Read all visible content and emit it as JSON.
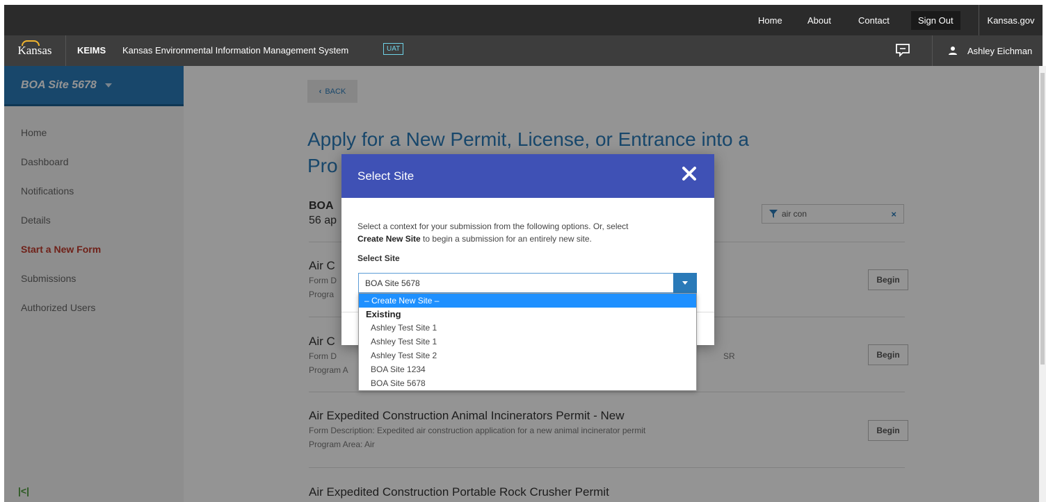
{
  "top_nav": {
    "home": "Home",
    "about": "About",
    "contact": "Contact",
    "sign_out": "Sign Out",
    "kansas_gov": "Kansas.gov"
  },
  "app_bar": {
    "logo_text": "Kansas",
    "short_name": "KEIMS",
    "full_name": "Kansas Environmental Information Management System",
    "env_badge": "UAT",
    "user_name": "Ashley Eichman"
  },
  "sidebar": {
    "site_name": "BOA Site 5678",
    "items": [
      {
        "label": "Home"
      },
      {
        "label": "Dashboard"
      },
      {
        "label": "Notifications"
      },
      {
        "label": "Details"
      },
      {
        "label": "Start a New Form",
        "active": true
      },
      {
        "label": "Submissions"
      },
      {
        "label": "Authorized Users"
      }
    ]
  },
  "main": {
    "back_label": "BACK",
    "title_line1": "Apply for a New Permit, License, or Entrance into a",
    "title_line2": "Pro",
    "site_label": "BOA",
    "count_label": "56 ap",
    "filter_value": "air con",
    "forms": [
      {
        "title": "Air C",
        "desc": "Form D",
        "program": "Progra"
      },
      {
        "title": "Air C",
        "desc": "Form D",
        "desc_tail": "SR",
        "program": "Program A"
      },
      {
        "title": "Air Expedited Construction Animal Incinerators Permit - New",
        "desc": "Form Description: Expedited air construction application for a new animal incinerator permit",
        "program": "Program Area: Air"
      },
      {
        "title": "Air Expedited Construction Portable Rock Crusher Permit"
      }
    ],
    "begin_label": "Begin"
  },
  "modal": {
    "title": "Select Site",
    "text_pre": "Select a context for your submission from the following options. Or, select",
    "text_bold": "Create New Site",
    "text_post": "to begin a submission for an entirely new site.",
    "select_label": "Select Site",
    "selected_value": "BOA Site 5678",
    "options": {
      "create_new": "– Create New Site –",
      "group_label": "Existing",
      "existing": [
        "Ashley Test Site 1",
        "Ashley Test Site 1",
        "Ashley Test Site 2",
        "BOA Site 1234",
        "BOA Site 5678"
      ]
    }
  },
  "colors": {
    "brand_blue": "#2a7ab8",
    "modal_header": "#3f51b5",
    "active_menu": "#c0392b",
    "dropdown_highlight": "#1e90ff"
  }
}
